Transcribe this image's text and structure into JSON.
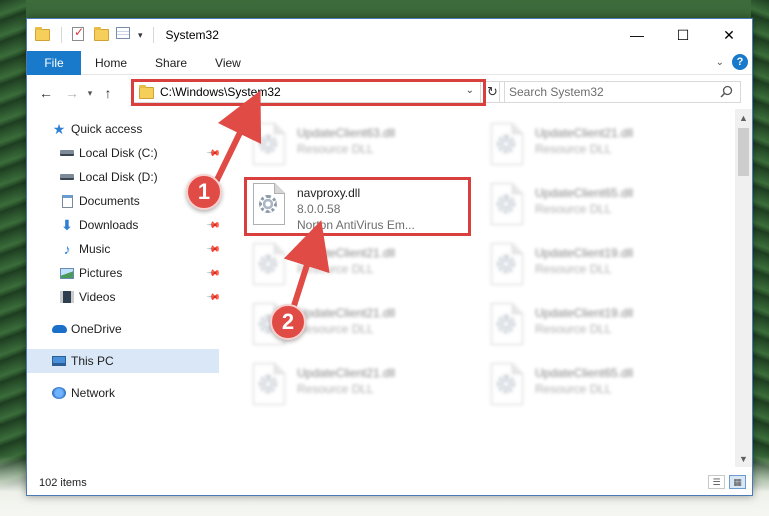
{
  "window": {
    "title": "System32",
    "controls": {
      "minimize": "—",
      "maximize": "☐",
      "close": "✕"
    }
  },
  "ribbon": {
    "file_tab": "File",
    "tabs": [
      "Home",
      "Share",
      "View"
    ],
    "help": "?"
  },
  "nav": {
    "address": "C:\\Windows\\System32",
    "search_placeholder": "Search System32"
  },
  "sidebar": {
    "items": [
      {
        "label": "Quick access",
        "icon": "star-icon",
        "pinned": false
      },
      {
        "label": "Local Disk (C:)",
        "icon": "drive-icon",
        "pinned": true
      },
      {
        "label": "Local Disk (D:)",
        "icon": "drive-icon",
        "pinned": false
      },
      {
        "label": "Documents",
        "icon": "documents-icon",
        "pinned": true
      },
      {
        "label": "Downloads",
        "icon": "downloads-icon",
        "pinned": true
      },
      {
        "label": "Music",
        "icon": "music-icon",
        "pinned": true
      },
      {
        "label": "Pictures",
        "icon": "pictures-icon",
        "pinned": true
      },
      {
        "label": "Videos",
        "icon": "videos-icon",
        "pinned": true
      },
      {
        "label": "OneDrive",
        "icon": "onedrive-icon",
        "pinned": false
      },
      {
        "label": "This PC",
        "icon": "pc-icon",
        "pinned": false,
        "selected": true
      },
      {
        "label": "Network",
        "icon": "network-icon",
        "pinned": false
      }
    ]
  },
  "files": {
    "highlighted": {
      "name": "navproxy.dll",
      "version": "8.0.0.58",
      "company": "Norton AntiVirus Em..."
    },
    "blurred": [
      {
        "name": "UpdateClient63.dll",
        "type": "Resource DLL"
      },
      {
        "name": "UpdateClient21.dll",
        "type": "Resource DLL"
      },
      {
        "name": "UpdateClient65.dll",
        "type": "Resource DLL"
      },
      {
        "name": "UpdateClient21.dll",
        "type": "Resource DLL"
      },
      {
        "name": "UpdateClient19.dll",
        "type": "Resource DLL"
      },
      {
        "name": "UpdateClient21.dll",
        "type": "Resource DLL"
      },
      {
        "name": "UpdateClient19.dll",
        "type": "Resource DLL"
      },
      {
        "name": "UpdateClient21.dll",
        "type": "Resource DLL"
      },
      {
        "name": "UpdateClient65.dll",
        "type": "Resource DLL"
      }
    ]
  },
  "status": {
    "item_count": "102 items"
  },
  "callouts": [
    "1",
    "2"
  ],
  "colors": {
    "accent": "#1979ca",
    "highlight": "#d9403d",
    "selection": "#d9e7f6"
  }
}
